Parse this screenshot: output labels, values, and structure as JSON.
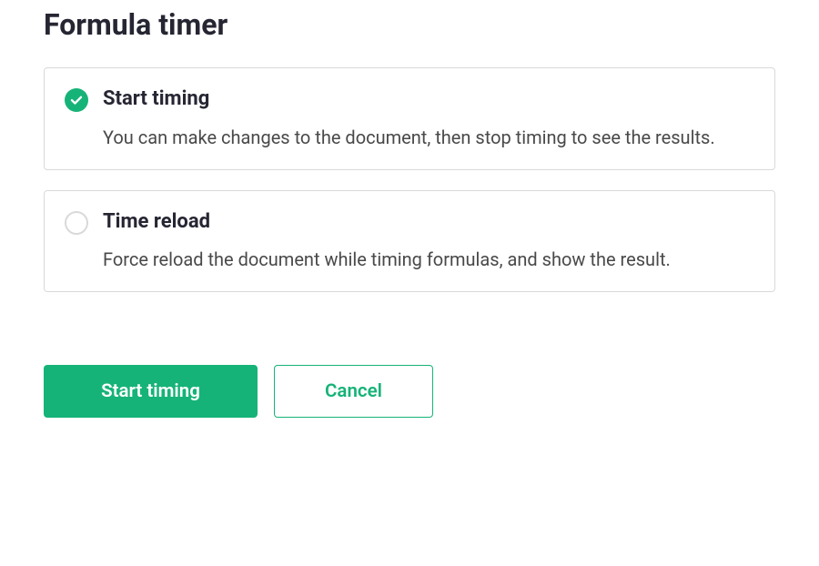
{
  "title": "Formula timer",
  "options": [
    {
      "id": "start-timing",
      "title": "Start timing",
      "description": "You can make changes to the document, then stop timing to see the results.",
      "selected": true
    },
    {
      "id": "time-reload",
      "title": "Time reload",
      "description": "Force reload the document while timing formulas, and show the result.",
      "selected": false
    }
  ],
  "buttons": {
    "primary": "Start timing",
    "cancel": "Cancel"
  },
  "colors": {
    "accent": "#16b378",
    "border": "#d9d9d9",
    "text": "#262633",
    "textMuted": "#494949"
  }
}
